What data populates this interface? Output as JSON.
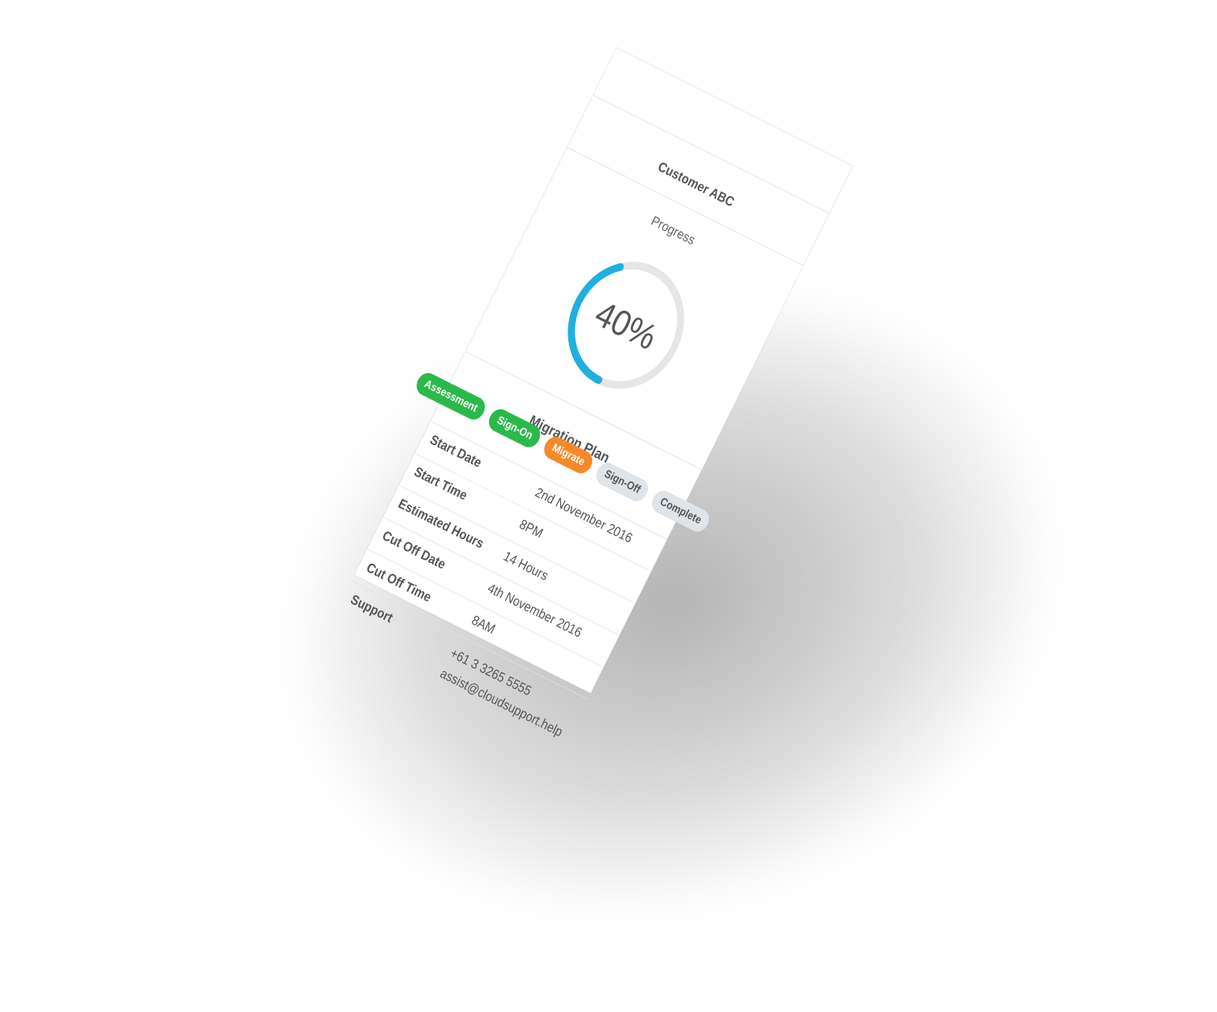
{
  "customer": {
    "title": "Customer ABC"
  },
  "progress": {
    "label": "Progress",
    "value_text": "40%",
    "value": 0.4,
    "track_color": "#e6e6e6",
    "fill_color": "#1fb0e0"
  },
  "migration_plan": {
    "title": "Migration Plan",
    "steps": [
      {
        "label": "Assessment",
        "state": "done",
        "color": "#2bb94a"
      },
      {
        "label": "Sign-On",
        "state": "done",
        "color": "#2bb94a"
      },
      {
        "label": "Migrate",
        "state": "active",
        "color": "#f5892a"
      },
      {
        "label": "Sign-Off",
        "state": "pending",
        "color": "#dfe4e8"
      },
      {
        "label": "Complete",
        "state": "pending",
        "color": "#dfe4e8"
      }
    ]
  },
  "details": {
    "start_date": {
      "label": "Start Date",
      "value": "2nd November 2016"
    },
    "start_time": {
      "label": "Start Time",
      "value": "8PM"
    },
    "estimated_hours": {
      "label": "Estimated Hours",
      "value": "14 Hours"
    },
    "cut_off_date": {
      "label": "Cut Off Date",
      "value": "4th November 2016"
    },
    "cut_off_time": {
      "label": "Cut Off Time",
      "value": "8AM"
    },
    "support": {
      "label": "Support",
      "phone": "+61 3 3265 5555",
      "email": "assist@cloudsupport.help"
    }
  }
}
